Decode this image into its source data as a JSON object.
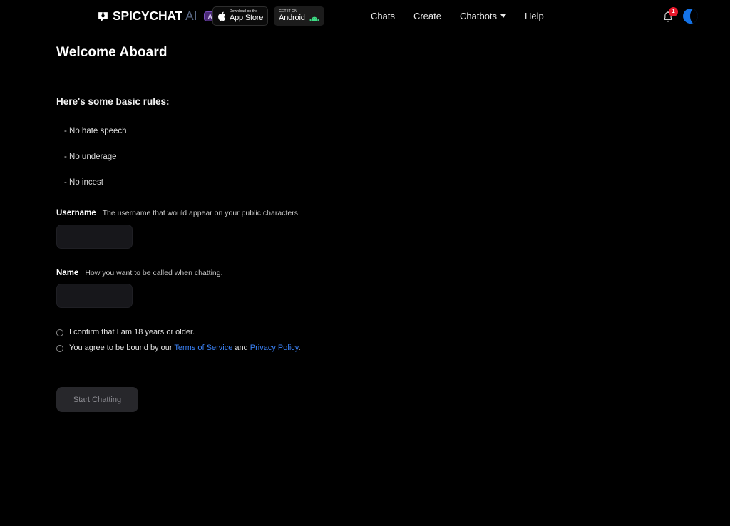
{
  "header": {
    "brand": {
      "logo_icon": "chat-bubble-icon",
      "name": "SPICYCHAT",
      "suffix": "AI",
      "badge": "ALPHA RELEASE",
      "badge_bg": "#4b2a77",
      "badge_text_color": "#d9c9f5"
    },
    "store_badges": [
      {
        "icon": "apple-icon",
        "small": "Download on the",
        "big": "App Store"
      },
      {
        "icon": "android-robot-icon",
        "small": "GET IT ON",
        "big": "Android"
      }
    ],
    "nav": [
      {
        "label": "Chats",
        "has_caret": false
      },
      {
        "label": "Create",
        "has_caret": false
      },
      {
        "label": "Chatbots",
        "has_caret": true
      },
      {
        "label": "Help",
        "has_caret": false
      }
    ],
    "notifications": {
      "icon": "bell-icon",
      "count": "1",
      "badge_color": "#e8192c"
    },
    "avatar": {
      "icon": "avatar-icon",
      "color": "#1472e6"
    }
  },
  "main": {
    "page_title": "Welcome Aboard",
    "rules_heading": "Here's some basic rules:",
    "rules": [
      "- No hate speech",
      "- No underage",
      "- No incest"
    ],
    "fields": [
      {
        "label": "Username",
        "hint": "The username that would appear on your public characters.",
        "value": "",
        "placeholder": ""
      },
      {
        "label": "Name",
        "hint": "How you want to be called when chatting.",
        "value": "",
        "placeholder": ""
      }
    ],
    "consents": [
      {
        "checked": false,
        "text_before": "I confirm that I am 18 years or older.",
        "link1": "",
        "text_middle": "",
        "link2": "",
        "text_after": ""
      },
      {
        "checked": false,
        "text_before": "You agree to be bound by our ",
        "link1": "Terms of Service",
        "text_middle": " and ",
        "link2": "Privacy Policy",
        "text_after": "."
      }
    ],
    "submit_label": "Start Chatting",
    "link_color": "#3b82f6"
  }
}
